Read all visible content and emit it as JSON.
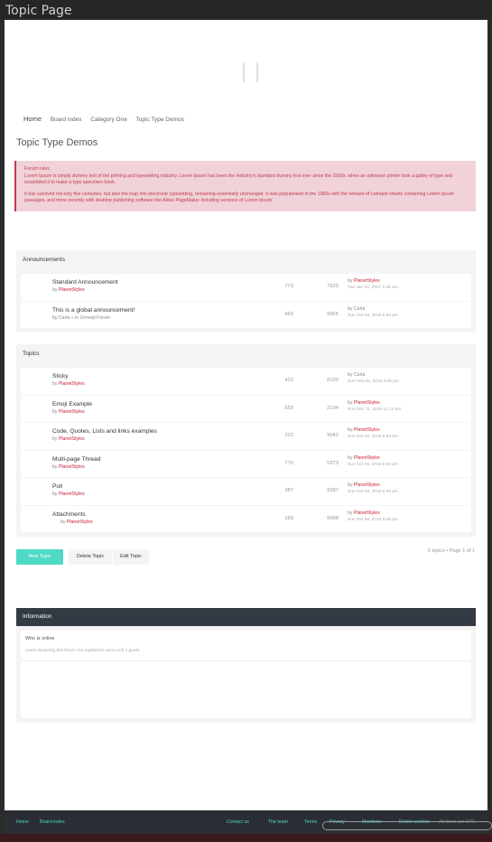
{
  "window": {
    "title": "Topic Page"
  },
  "breadcrumbs": [
    "Home",
    "Board index",
    "Category One",
    "Topic Type Demos"
  ],
  "page_title": "Topic Type Demos",
  "forum_rules": {
    "title": "Forum rules",
    "p1": "Lorem Ipsum is simply dummy text of the printing and typesetting industry. Lorem Ipsum has been the industry's standard dummy text ever since the 1500s, when an unknown printer took a galley of type and scrambled it to make a type specimen book.",
    "p2": "It has survived not only five centuries, but also the leap into electronic typesetting, remaining essentially unchanged. It was popularised in the 1960s with the release of Letraset sheets containing Lorem Ipsum passages, and more recently with desktop publishing software like Aldus PageMaker including versions of Lorem Ipsum."
  },
  "announcements": {
    "header": "Announcements",
    "rows": [
      {
        "title": "Standard Announcement",
        "by": "by",
        "author": "PlanetStyles",
        "suffix": "",
        "replies": "773",
        "views": "7520",
        "last_by": "by",
        "last_user": "PlanetStyles",
        "last_date": "Tue Jan 03, 2017 1:36 am"
      },
      {
        "title": "This is a global announcement!",
        "by": "by",
        "author": "",
        "suffix": "Carla » in Unread Forum",
        "replies": "469",
        "views": "9965",
        "last_by": "by",
        "last_user": "Carla",
        "last_date": "Sun Oct 09, 2016 5:58 pm"
      }
    ]
  },
  "topics": {
    "header": "Topics",
    "rows": [
      {
        "title": "Sticky",
        "by": "by",
        "author": "PlanetStyles",
        "replies": "433",
        "views": "8100",
        "last_by": "by",
        "last_user": "Carla",
        "last_date": "Sun Feb 03, 2019 3:55 pm"
      },
      {
        "title": "Emoji Example",
        "by": "by",
        "author": "PlanetStyles",
        "replies": "650",
        "views": "2194",
        "last_by": "by",
        "last_user": "PlanetStyles",
        "last_date": "Sun Dec 11, 2016 12:14 am"
      },
      {
        "title": "Code, Quotes, Lists and links examples",
        "by": "by",
        "author": "PlanetStyles",
        "replies": "322",
        "views": "9042",
        "last_by": "by",
        "last_user": "PlanetStyles",
        "last_date": "Sun Oct 09, 2016 6:59 pm"
      },
      {
        "title": "Multi-page Thread",
        "by": "by",
        "author": "PlanetStyles",
        "replies": "770",
        "views": "5373",
        "last_by": "by",
        "last_user": "PlanetStyles",
        "last_date": "Sun Oct 09, 2016 6:50 pm"
      },
      {
        "title": "Poll",
        "by": "by",
        "author": "PlanetStyles",
        "replies": "387",
        "views": "9287",
        "last_by": "by",
        "last_user": "PlanetStyles",
        "last_date": "Sun Oct 09, 2016 6:46 pm"
      },
      {
        "title": "Attachments",
        "by": "by",
        "author": "PlanetStyles",
        "replies": "189",
        "views": "5688",
        "last_by": "by",
        "last_user": "PlanetStyles",
        "last_date": "Sun Oct 09, 2016 6:45 pm"
      }
    ]
  },
  "actions": {
    "new_topic": "New Topic",
    "delete_topic": "Delete Topic",
    "edit_topic": "Edit Topic"
  },
  "pagination": "6 topics • Page 1 of 1",
  "information": {
    "header": "Information",
    "who_online": "Who is online",
    "browsing": "Users browsing this forum: No registered users and 1 guest"
  },
  "footer": {
    "home": "Home",
    "board_index": "Board index",
    "contact": "Contact us",
    "team": "The team",
    "terms": "Terms",
    "privacy": "Privacy",
    "members": "Members",
    "delete_cookies": "Delete cookies",
    "times": "All times are UTC"
  },
  "colors": {
    "accent": "#4fd9c7",
    "link_red": "#c8202e",
    "rules_bg": "#f0d2d8",
    "info_header": "#333a43"
  }
}
